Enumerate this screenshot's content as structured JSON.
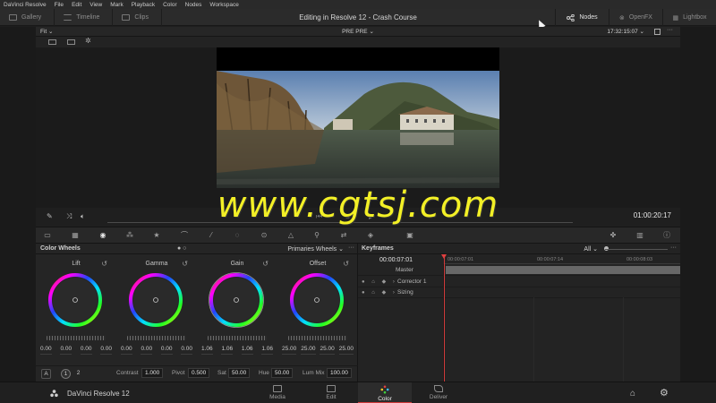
{
  "menu": [
    "DaVinci Resolve",
    "File",
    "Edit",
    "View",
    "Mark",
    "Playback",
    "Color",
    "Nodes",
    "Workspace"
  ],
  "header": {
    "title": "Editing in Resolve 12 - Crash Course",
    "left_tabs": [
      {
        "label": "Gallery"
      },
      {
        "label": "Timeline"
      },
      {
        "label": "Clips"
      }
    ],
    "right_tabs": [
      {
        "label": "Nodes"
      },
      {
        "label": "OpenFX"
      },
      {
        "label": "Lightbox"
      }
    ]
  },
  "viewer": {
    "zoom": "Fit",
    "clip_label": "PRE PRE",
    "source_timecode": "17:32:15:07",
    "record_timecode": "01:00:20:17"
  },
  "color_wheels": {
    "title": "Color Wheels",
    "mode": "Primaries Wheels",
    "wheels": [
      {
        "name": "Lift",
        "values": [
          "0.00",
          "0.00",
          "0.00",
          "0.00"
        ]
      },
      {
        "name": "Gamma",
        "values": [
          "0.00",
          "0.00",
          "0.00",
          "0.00"
        ]
      },
      {
        "name": "Gain",
        "values": [
          "1.06",
          "1.06",
          "1.06",
          "1.06"
        ]
      },
      {
        "name": "Offset",
        "values": [
          "25.00",
          "25.00",
          "25.00",
          "25.00"
        ]
      }
    ],
    "footer": {
      "mode_a": "A",
      "page_1": "1",
      "page_2": "2",
      "contrast_label": "Contrast",
      "contrast": "1.000",
      "pivot_label": "Pivot",
      "pivot": "0.500",
      "sat_label": "Sat",
      "sat": "50.00",
      "hue_label": "Hue",
      "hue": "50.00",
      "lummix_label": "Lum Mix",
      "lummix": "100.00"
    }
  },
  "keyframes": {
    "title": "Keyframes",
    "filter": "All",
    "timecode": "00:00:07:01",
    "ruler": [
      "00:00:07:01",
      "00:00:07:14",
      "00:00:08:03"
    ],
    "rows": [
      {
        "name": "Master"
      },
      {
        "name": "Corrector 1"
      },
      {
        "name": "Sizing"
      }
    ]
  },
  "pages": {
    "brand": "DaVinci Resolve 12",
    "tabs": [
      {
        "label": "Media"
      },
      {
        "label": "Edit"
      },
      {
        "label": "Color"
      },
      {
        "label": "Deliver"
      }
    ]
  },
  "watermark": "www.cgtsj.com",
  "colors": {
    "accent": "#d23a3a",
    "watermark": "#f3f026"
  }
}
